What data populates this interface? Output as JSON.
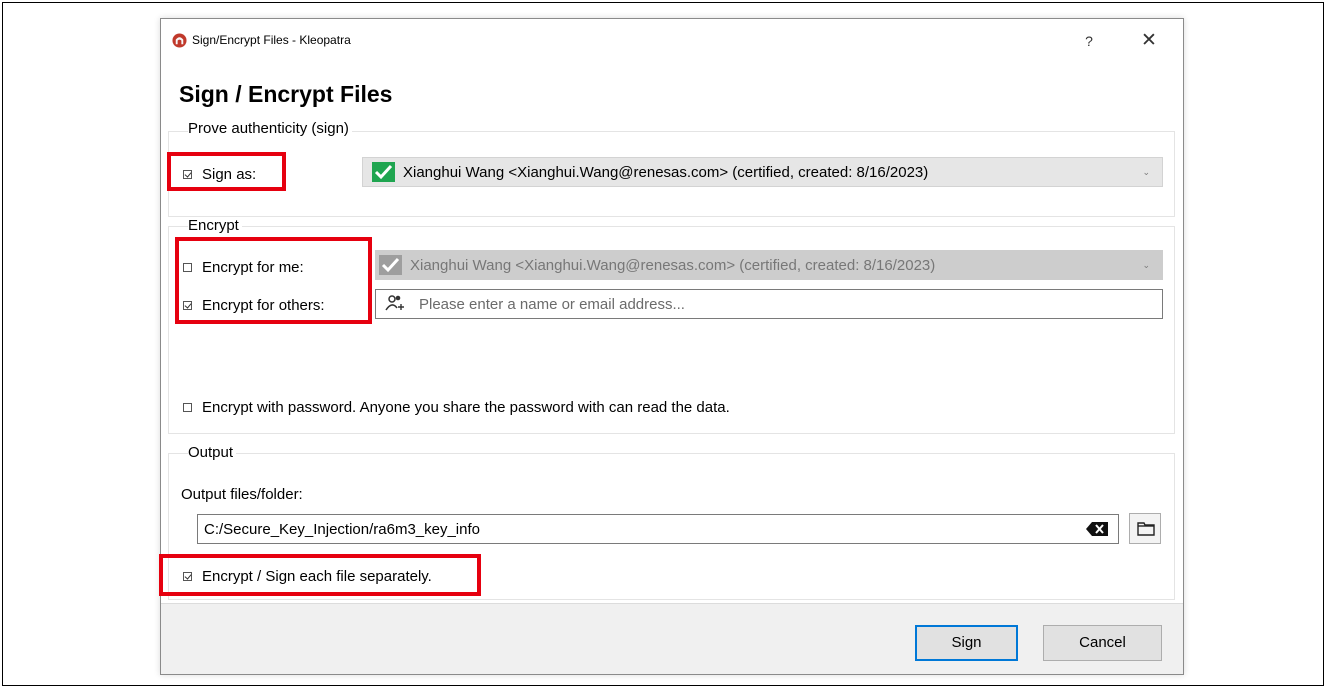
{
  "window": {
    "title": "Sign/Encrypt Files - Kleopatra",
    "help_label": "?",
    "close_label": "✕"
  },
  "page_heading": "Sign / Encrypt Files",
  "sign_group": {
    "title": "Prove authenticity (sign)",
    "sign_as_label": "Sign as:",
    "sign_as_checked": true,
    "sign_as_value": "Xianghui Wang <Xianghui.Wang@renesas.com> (certified,  created: 8/16/2023)"
  },
  "encrypt_group": {
    "title": "Encrypt",
    "for_me_label": "Encrypt for me:",
    "for_me_checked": false,
    "for_me_value": "Xianghui Wang <Xianghui.Wang@renesas.com> (certified,  created: 8/16/2023)",
    "for_others_label": "Encrypt for others:",
    "for_others_checked": true,
    "for_others_placeholder": "Please enter a name or email address...",
    "with_password_label": "Encrypt with password. Anyone you share the password with can read the data.",
    "with_password_checked": false
  },
  "output_group": {
    "title": "Output",
    "folder_label": "Output files/folder:",
    "folder_value": "C:/Secure_Key_Injection/ra6m3_key_info",
    "separately_label": "Encrypt / Sign each file separately.",
    "separately_checked": true
  },
  "buttons": {
    "sign_label": "Sign",
    "cancel_label": "Cancel"
  },
  "colors": {
    "highlight_box": "#e6000f",
    "cert_ok_green": "#1fa550",
    "default_button_border": "#0078d7"
  }
}
